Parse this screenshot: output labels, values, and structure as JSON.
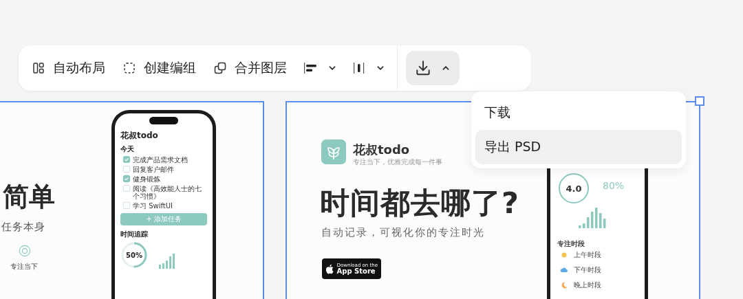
{
  "toolbar": {
    "actions": [
      {
        "label": "自动布局"
      },
      {
        "label": "创建编组"
      },
      {
        "label": "合并图层"
      }
    ],
    "align_menus": [
      {
        "expanded": false
      },
      {
        "expanded": false
      }
    ],
    "export_button": {
      "expanded": true
    }
  },
  "export_menu": {
    "items": [
      {
        "label": "下载",
        "selected": false
      },
      {
        "label": "导出 PSD",
        "selected": true
      }
    ]
  },
  "canvas": {
    "frames": [
      {
        "kind": "tasks",
        "selected": true,
        "headline": "简单",
        "subtitle": "任务本身",
        "feature": {
          "title": "专注当下"
        },
        "phone": {
          "app_title": "花叔todo",
          "section": "今天",
          "tasks": [
            {
              "label": "完成产品需求文档",
              "done": true
            },
            {
              "label": "回复客户邮件",
              "done": false
            },
            {
              "label": "健身锻炼",
              "done": true
            },
            {
              "label": "阅读《高效能人士的七个习惯》",
              "done": false
            },
            {
              "label": "学习 SwiftUI",
              "done": false
            }
          ],
          "add_button": "+ 添加任务",
          "tracking_title": "时间追踪",
          "percent": "50%",
          "level": 0.5
        }
      },
      {
        "kind": "stats",
        "selected": true,
        "app_name": "花叔todo",
        "tagline": "专注当下，优雅完成每一件事",
        "headline": "时间都去哪了?",
        "subtitle": "自动记录，可视化你的专注时光",
        "store_badge": {
          "small": "Download on the",
          "large": "App Store"
        },
        "phone": {
          "score": "4.0",
          "rate": "80%",
          "section": "专注时段",
          "periods": [
            {
              "label": "上午时段"
            },
            {
              "label": "下午时段"
            },
            {
              "label": "晚上时段"
            }
          ]
        }
      }
    ]
  }
}
